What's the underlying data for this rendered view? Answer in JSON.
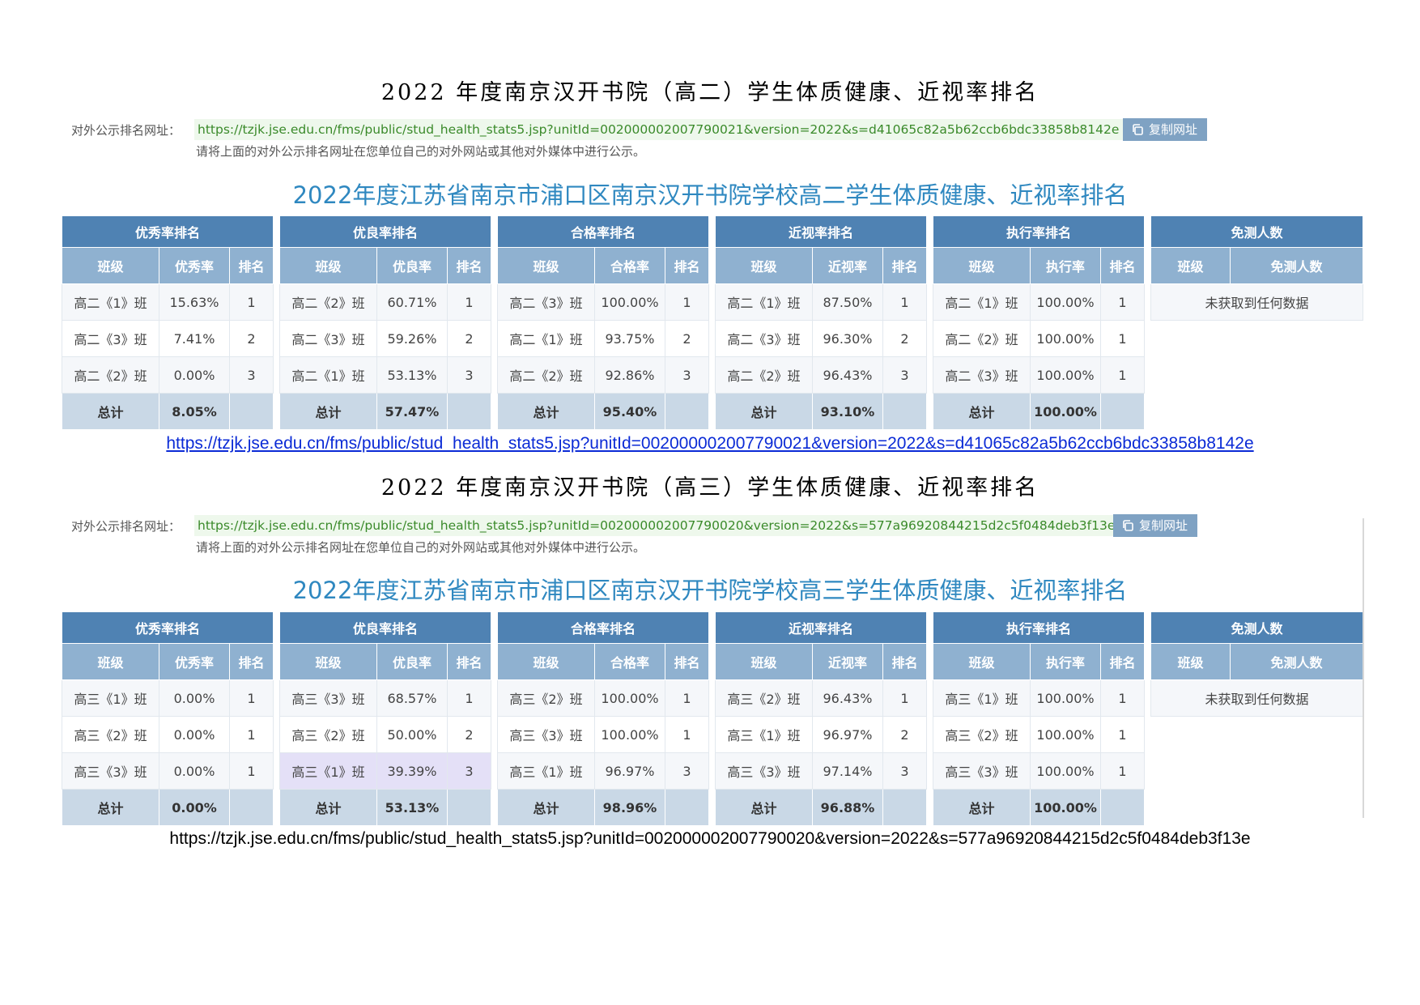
{
  "sections": [
    {
      "heading": "2022 年度南京汉开书院（高二）学生体质健康、近视率排名",
      "pub_label": "对外公示排名网址：",
      "pub_url": "https://tzjk.jse.edu.cn/fms/public/stud_health_stats5.jsp?unitId=002000002007790021&version=2022&s=d41065c82a5b62ccb6bdc33858b8142e",
      "copy_label": "复制网址",
      "hint": "请将上面的对外公示排名网址在您单位自己的对外网站或其他对外媒体中进行公示。",
      "title": "2022年度江苏省南京市浦口区南京汉开书院学校高二学生体质健康、近视率排名",
      "tables": [
        {
          "caption": "优秀率排名",
          "cols": [
            "班级",
            "优秀率",
            "排名"
          ],
          "rows": [
            [
              "高二《1》班",
              "15.63%",
              "1"
            ],
            [
              "高二《3》班",
              "7.41%",
              "2"
            ],
            [
              "高二《2》班",
              "0.00%",
              "3"
            ]
          ],
          "total": [
            "总计",
            "8.05%",
            ""
          ]
        },
        {
          "caption": "优良率排名",
          "cols": [
            "班级",
            "优良率",
            "排名"
          ],
          "rows": [
            [
              "高二《2》班",
              "60.71%",
              "1"
            ],
            [
              "高二《3》班",
              "59.26%",
              "2"
            ],
            [
              "高二《1》班",
              "53.13%",
              "3"
            ]
          ],
          "total": [
            "总计",
            "57.47%",
            ""
          ]
        },
        {
          "caption": "合格率排名",
          "cols": [
            "班级",
            "合格率",
            "排名"
          ],
          "rows": [
            [
              "高二《3》班",
              "100.00%",
              "1"
            ],
            [
              "高二《1》班",
              "93.75%",
              "2"
            ],
            [
              "高二《2》班",
              "92.86%",
              "3"
            ]
          ],
          "total": [
            "总计",
            "95.40%",
            ""
          ]
        },
        {
          "caption": "近视率排名",
          "cols": [
            "班级",
            "近视率",
            "排名"
          ],
          "rows": [
            [
              "高二《1》班",
              "87.50%",
              "1"
            ],
            [
              "高二《3》班",
              "96.30%",
              "2"
            ],
            [
              "高二《2》班",
              "96.43%",
              "3"
            ]
          ],
          "total": [
            "总计",
            "93.10%",
            ""
          ]
        },
        {
          "caption": "执行率排名",
          "cols": [
            "班级",
            "执行率",
            "排名"
          ],
          "rows": [
            [
              "高二《1》班",
              "100.00%",
              "1"
            ],
            [
              "高二《2》班",
              "100.00%",
              "1"
            ],
            [
              "高二《3》班",
              "100.00%",
              "1"
            ]
          ],
          "total": [
            "总计",
            "100.00%",
            ""
          ]
        }
      ],
      "exempt": {
        "caption": "免测人数",
        "cols": [
          "班级",
          "免测人数"
        ],
        "nodata": "未获取到任何数据"
      },
      "url_line": "https://tzjk.jse.edu.cn/fms/public/stud_health_stats5.jsp?unitId=002000002007790021&version=2022&s=d41065c82a5b62ccb6bdc33858b8142e"
    },
    {
      "heading": "2022 年度南京汉开书院（高三）学生体质健康、近视率排名",
      "pub_label": "对外公示排名网址：",
      "pub_url": "https://tzjk.jse.edu.cn/fms/public/stud_health_stats5.jsp?unitId=002000002007790020&version=2022&s=577a96920844215d2c5f0484deb3f13e",
      "copy_label": "复制网址",
      "hint": "请将上面的对外公示排名网址在您单位自己的对外网站或其他对外媒体中进行公示。",
      "title": "2022年度江苏省南京市浦口区南京汉开书院学校高三学生体质健康、近视率排名",
      "tables": [
        {
          "caption": "优秀率排名",
          "cols": [
            "班级",
            "优秀率",
            "排名"
          ],
          "rows": [
            [
              "高三《1》班",
              "0.00%",
              "1"
            ],
            [
              "高三《2》班",
              "0.00%",
              "1"
            ],
            [
              "高三《3》班",
              "0.00%",
              "1"
            ]
          ],
          "total": [
            "总计",
            "0.00%",
            ""
          ]
        },
        {
          "caption": "优良率排名",
          "cols": [
            "班级",
            "优良率",
            "排名"
          ],
          "rows": [
            [
              "高三《3》班",
              "68.57%",
              "1"
            ],
            [
              "高三《2》班",
              "50.00%",
              "2"
            ],
            [
              "高三《1》班",
              "39.39%",
              "3"
            ]
          ],
          "total": [
            "总计",
            "53.13%",
            ""
          ],
          "highlight_row": 2
        },
        {
          "caption": "合格率排名",
          "cols": [
            "班级",
            "合格率",
            "排名"
          ],
          "rows": [
            [
              "高三《2》班",
              "100.00%",
              "1"
            ],
            [
              "高三《3》班",
              "100.00%",
              "1"
            ],
            [
              "高三《1》班",
              "96.97%",
              "3"
            ]
          ],
          "total": [
            "总计",
            "98.96%",
            ""
          ]
        },
        {
          "caption": "近视率排名",
          "cols": [
            "班级",
            "近视率",
            "排名"
          ],
          "rows": [
            [
              "高三《2》班",
              "96.43%",
              "1"
            ],
            [
              "高三《1》班",
              "96.97%",
              "2"
            ],
            [
              "高三《3》班",
              "97.14%",
              "3"
            ]
          ],
          "total": [
            "总计",
            "96.88%",
            ""
          ]
        },
        {
          "caption": "执行率排名",
          "cols": [
            "班级",
            "执行率",
            "排名"
          ],
          "rows": [
            [
              "高三《1》班",
              "100.00%",
              "1"
            ],
            [
              "高三《2》班",
              "100.00%",
              "1"
            ],
            [
              "高三《3》班",
              "100.00%",
              "1"
            ]
          ],
          "total": [
            "总计",
            "100.00%",
            ""
          ]
        }
      ],
      "exempt": {
        "caption": "免测人数",
        "cols": [
          "班级",
          "免测人数"
        ],
        "nodata": "未获取到任何数据"
      },
      "url_line": "https://tzjk.jse.edu.cn/fms/public/stud_health_stats5.jsp?unitId=002000002007790020&version=2022&s=577a96920844215d2c5f0484deb3f13e"
    }
  ]
}
